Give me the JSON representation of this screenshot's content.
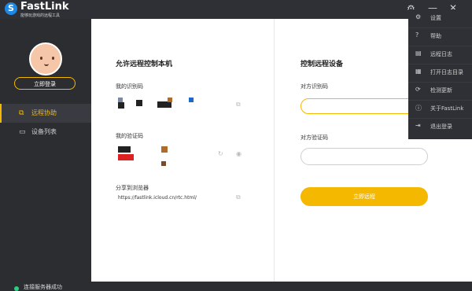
{
  "app": {
    "logo_letter": "S",
    "brand": "FastLink",
    "brand_sub": "能够玩游戏的远程工具",
    "accent": "#f5b800",
    "sidebar_bg": "#2b2d31",
    "menu_bg": "#2f3035"
  },
  "titlebar": {
    "settings_icon": "gear-icon",
    "min_icon": "minimize-icon",
    "close_icon": "close-icon",
    "min_glyph": "—",
    "close_glyph": "✕"
  },
  "sidebar": {
    "login_button": "立即登录",
    "items": [
      {
        "label": "远程协助",
        "icon": "remote-assist-icon",
        "glyph": "⧉",
        "active": true
      },
      {
        "label": "设备列表",
        "icon": "device-list-icon",
        "glyph": "▭",
        "active": false
      }
    ],
    "status": {
      "text": "连接服务器成功",
      "color": "#27d17f"
    }
  },
  "left": {
    "title": "允许远程控制本机",
    "id_label": "我的识别码",
    "code_label": "我的验证码",
    "share_label": "分享到浏览器",
    "share_url": "https://fastlink.icloud.cn/rtc.html/",
    "copy_glyph": "⧉",
    "refresh_glyph": "↻",
    "eye_glyph": "◉"
  },
  "right": {
    "title": "控制远程设备",
    "partner_id_label": "对方识别码",
    "partner_code_label": "对方验证码",
    "partner_id_placeholder": "",
    "partner_code_placeholder": "",
    "connect_button": "立即远程"
  },
  "menu": {
    "items": [
      {
        "label": "设置",
        "icon": "gear-icon",
        "glyph": "⚙"
      },
      {
        "label": "帮助",
        "icon": "help-icon",
        "glyph": "?"
      },
      {
        "label": "远程日志",
        "icon": "log-icon",
        "glyph": "▤"
      },
      {
        "label": "打开日志目录",
        "icon": "folder-icon",
        "glyph": "▦"
      },
      {
        "label": "检测更新",
        "icon": "update-icon",
        "glyph": "⟳"
      },
      {
        "label": "关于FastLink",
        "icon": "info-icon",
        "glyph": "ⓘ"
      },
      {
        "label": "退出登录",
        "icon": "logout-icon",
        "glyph": "⇥"
      }
    ]
  }
}
